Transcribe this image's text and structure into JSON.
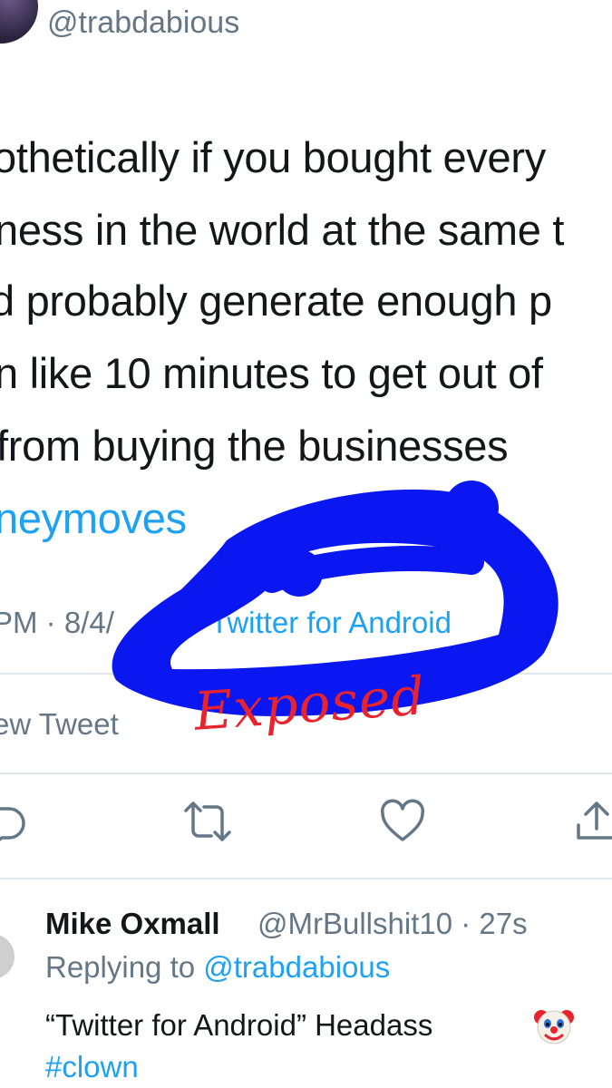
{
  "tweet": {
    "handle": "@trabdabious",
    "lines": [
      "othetically if you bought every",
      "ness in the world at the same t",
      "d probably generate enough p",
      "n like 10 minutes to get out of",
      "from buying the businesses",
      "neymoves"
    ],
    "meta": "PM · 8/4/",
    "source": "Twitter for Android",
    "view_tweet": "ew Tweet"
  },
  "annotation": {
    "text": "Exposed",
    "scribble_color": "#0a17f0",
    "text_color": "#e8232e"
  },
  "actions": [
    "reply-icon",
    "retweet-icon",
    "like-icon",
    "share-icon"
  ],
  "reply": {
    "name": "Mike Oxmall",
    "handle_time": "@MrBullshit10 · 27s",
    "replying_prefix": "Replying to ",
    "replying_mention": "@trabdabious",
    "text": "“Twitter for Android” Headass",
    "emoji": "clown-face-icon",
    "hashtag": "#clown"
  },
  "colors": {
    "link": "#1da1f2",
    "secondary": "#657786",
    "primary": "#14171a",
    "divider": "#e1e8ed"
  }
}
